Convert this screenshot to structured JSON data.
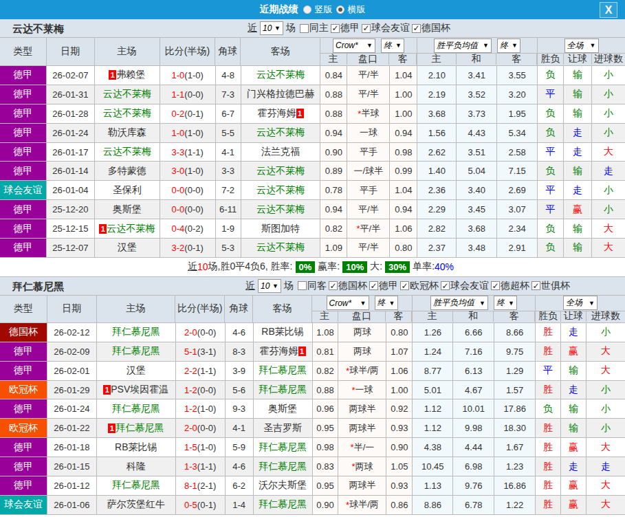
{
  "titlebar": {
    "title": "近期战绩",
    "radio_vertical": "竖版",
    "radio_horizontal": "横版",
    "selected": "横版",
    "close": "X"
  },
  "palette": {
    "header_blue": "#1896d5",
    "chrome": "#dbe4ec",
    "border": "#bbbbbb",
    "alt_row": "#f0f0f0",
    "asian_bg": "#fefaf8",
    "euro_bg": "#f2f9fd",
    "focus_green": "#008000",
    "red": "#ff0000",
    "blue": "#0000ff",
    "text": "#333333",
    "league_colors": {
      "德甲": "#990099",
      "球会友谊": "#00a8a8",
      "德国杯": "#a00800",
      "欧冠杯": "#f75000"
    },
    "result_colors": {
      "胜": "#ff0000",
      "平": "#0000ff",
      "负": "#008000",
      "赢": "#ff0000",
      "走": "#0000ff",
      "输": "#008000",
      "大": "#ff0000",
      "小": "#008000"
    }
  },
  "sections": [
    {
      "team": "云达不莱梅",
      "filter": {
        "near_label": "近",
        "count": "10",
        "games_label": "场"
      },
      "checkboxes": [
        {
          "label": "同主",
          "checked": false
        },
        {
          "label": "德甲",
          "checked": true
        },
        {
          "label": "球会友谊",
          "checked": true
        },
        {
          "label": "德国杯",
          "checked": true
        }
      ],
      "header": {
        "cols": [
          "类型",
          "日期",
          "主场",
          "比分(半场)",
          "角球",
          "客场"
        ],
        "selects": [
          "Crow*",
          "终",
          "胜平负均值",
          "终",
          "全场"
        ],
        "sub": [
          "主",
          "盘口",
          "客",
          "主",
          "和",
          "客",
          "胜负",
          "让球",
          "进球数"
        ]
      },
      "rows": [
        {
          "league": "德甲",
          "date": "26-02-07",
          "home": {
            "n": "弗赖堡",
            "pre": "1",
            "post": "",
            "f": false
          },
          "ft": "1-0",
          "ht": "(1-0)",
          "corner": "4-8",
          "away": {
            "n": "云达不莱梅",
            "pre": "",
            "post": "",
            "f": true
          },
          "w1": "0.84",
          "hcap": "平/半",
          "w2": "1.04",
          "o1": "2.10",
          "o2": "3.41",
          "o3": "3.55",
          "r1": "负",
          "r2": "输",
          "r3": "小"
        },
        {
          "league": "德甲",
          "date": "26-01-31",
          "home": {
            "n": "云达不莱梅",
            "pre": "",
            "post": "",
            "f": true
          },
          "ft": "1-1",
          "ht": "(0-0)",
          "corner": "7-3",
          "away": {
            "n": "门兴格拉德巴赫",
            "pre": "",
            "post": "",
            "f": false
          },
          "w1": "0.88",
          "hcap": "平/半",
          "w2": "1.00",
          "o1": "2.19",
          "o2": "3.52",
          "o3": "3.20",
          "r1": "平",
          "r2": "输",
          "r3": "小"
        },
        {
          "league": "德甲",
          "date": "26-01-28",
          "home": {
            "n": "云达不莱梅",
            "pre": "",
            "post": "",
            "f": true
          },
          "ft": "0-2",
          "ht": "(0-1)",
          "corner": "6-7",
          "away": {
            "n": "霍芬海姆",
            "pre": "",
            "post": "1",
            "f": false
          },
          "w1": "0.88",
          "hcap": "*半球",
          "w2": "1.00",
          "o1": "3.68",
          "o2": "3.73",
          "o3": "1.95",
          "r1": "负",
          "r2": "输",
          "r3": "小"
        },
        {
          "league": "德甲",
          "date": "26-01-24",
          "home": {
            "n": "勒沃库森",
            "pre": "",
            "post": "",
            "f": false
          },
          "ft": "1-0",
          "ht": "(1-0)",
          "corner": "5-5",
          "away": {
            "n": "云达不莱梅",
            "pre": "",
            "post": "",
            "f": true
          },
          "w1": "0.94",
          "hcap": "一球",
          "w2": "0.94",
          "o1": "1.56",
          "o2": "4.43",
          "o3": "5.34",
          "r1": "负",
          "r2": "走",
          "r3": "小"
        },
        {
          "league": "德甲",
          "date": "26-01-17",
          "home": {
            "n": "云达不莱梅",
            "pre": "",
            "post": "",
            "f": true
          },
          "ft": "3-3",
          "ht": "(1-1)",
          "corner": "4-1",
          "away": {
            "n": "法兰克福",
            "pre": "",
            "post": "",
            "f": false
          },
          "w1": "0.90",
          "hcap": "平手",
          "w2": "0.98",
          "o1": "2.62",
          "o2": "3.51",
          "o3": "2.58",
          "r1": "平",
          "r2": "走",
          "r3": "大"
        },
        {
          "league": "德甲",
          "date": "26-01-14",
          "home": {
            "n": "多特蒙德",
            "pre": "",
            "post": "",
            "f": false
          },
          "ft": "3-0",
          "ht": "(1-0)",
          "corner": "3-3",
          "away": {
            "n": "云达不莱梅",
            "pre": "",
            "post": "",
            "f": true
          },
          "w1": "0.89",
          "hcap": "一/球半",
          "w2": "0.99",
          "o1": "1.40",
          "o2": "5.04",
          "o3": "7.15",
          "r1": "负",
          "r2": "输",
          "r3": "走"
        },
        {
          "league": "球会友谊",
          "date": "26-01-04",
          "home": {
            "n": "圣保利",
            "pre": "",
            "post": "",
            "f": false
          },
          "ft": "0-0",
          "ht": "(0-0)",
          "corner": "7-2",
          "away": {
            "n": "云达不莱梅",
            "pre": "",
            "post": "",
            "f": true
          },
          "w1": "0.78",
          "hcap": "平手",
          "w2": "1.04",
          "o1": "2.36",
          "o2": "3.40",
          "o3": "2.69",
          "r1": "平",
          "r2": "走",
          "r3": "小"
        },
        {
          "league": "德甲",
          "date": "25-12-20",
          "home": {
            "n": "奥斯堡",
            "pre": "",
            "post": "",
            "f": false
          },
          "ft": "0-0",
          "ht": "(0-0)",
          "corner": "6-11",
          "away": {
            "n": "云达不莱梅",
            "pre": "",
            "post": "",
            "f": true
          },
          "w1": "0.94",
          "hcap": "平/半",
          "w2": "0.94",
          "o1": "2.29",
          "o2": "3.45",
          "o3": "3.07",
          "r1": "平",
          "r2": "赢",
          "r3": "小"
        },
        {
          "league": "德甲",
          "date": "25-12-15",
          "home": {
            "n": "云达不莱梅",
            "pre": "1",
            "post": "",
            "f": true
          },
          "ft": "0-4",
          "ht": "(0-2)",
          "corner": "1-9",
          "away": {
            "n": "斯图加特",
            "pre": "",
            "post": "",
            "f": false
          },
          "w1": "0.82",
          "hcap": "*平/半",
          "w2": "1.06",
          "o1": "2.82",
          "o2": "3.68",
          "o3": "2.34",
          "r1": "负",
          "r2": "输",
          "r3": "大"
        },
        {
          "league": "德甲",
          "date": "25-12-07",
          "home": {
            "n": "汉堡",
            "pre": "",
            "post": "",
            "f": false
          },
          "ft": "3-2",
          "ht": "(0-1)",
          "corner": "5-3",
          "away": {
            "n": "云达不莱梅",
            "pre": "",
            "post": "",
            "f": true
          },
          "w1": "1.09",
          "hcap": "平/半",
          "w2": "0.80",
          "o1": "2.37",
          "o2": "3.48",
          "o3": "2.91",
          "r1": "负",
          "r2": "输",
          "r3": "大"
        }
      ],
      "summary": {
        "near": "近",
        "count": "10",
        "text": "场,胜0平4负6, 胜率:",
        "win": "0%",
        "label2": "赢率:",
        "win2": "10%",
        "label3": "大:",
        "big": "30%",
        "label4": "单率:",
        "single": "40%"
      }
    },
    {
      "team": "拜仁慕尼黑",
      "filter": {
        "near_label": "近",
        "count": "10",
        "games_label": "场"
      },
      "checkboxes": [
        {
          "label": "同客",
          "checked": false
        },
        {
          "label": "德国杯",
          "checked": true
        },
        {
          "label": "德甲",
          "checked": true
        },
        {
          "label": "欧冠杯",
          "checked": true
        },
        {
          "label": "球会友谊",
          "checked": true
        },
        {
          "label": "德超杯",
          "checked": true
        },
        {
          "label": "世俱杯",
          "checked": true
        }
      ],
      "header": {
        "cols": [
          "类型",
          "日期",
          "主场",
          "比分(半场)",
          "角球",
          "客场"
        ],
        "selects": [
          "Crow*",
          "终",
          "胜平负均值",
          "终",
          "全场"
        ],
        "sub": [
          "主",
          "盘口",
          "客",
          "主",
          "和",
          "客",
          "胜负",
          "让球",
          "进球数"
        ]
      },
      "rows": [
        {
          "league": "德国杯",
          "date": "26-02-12",
          "home": {
            "n": "拜仁慕尼黑",
            "pre": "",
            "post": "",
            "f": true
          },
          "ft": "2-0",
          "ht": "(0-0)",
          "corner": "4-6",
          "away": {
            "n": "RB莱比锡",
            "pre": "",
            "post": "",
            "f": false
          },
          "w1": "1.08",
          "hcap": "两球",
          "w2": "0.80",
          "o1": "1.26",
          "o2": "6.66",
          "o3": "8.66",
          "r1": "胜",
          "r2": "走",
          "r3": "小"
        },
        {
          "league": "德甲",
          "date": "26-02-09",
          "home": {
            "n": "拜仁慕尼黑",
            "pre": "",
            "post": "",
            "f": true
          },
          "ft": "5-1",
          "ht": "(3-1)",
          "corner": "8-3",
          "away": {
            "n": "霍芬海姆",
            "pre": "",
            "post": "1",
            "f": false
          },
          "w1": "0.81",
          "hcap": "两球",
          "w2": "1.07",
          "o1": "1.24",
          "o2": "7.16",
          "o3": "9.75",
          "r1": "胜",
          "r2": "赢",
          "r3": "大"
        },
        {
          "league": "德甲",
          "date": "26-02-01",
          "home": {
            "n": "汉堡",
            "pre": "",
            "post": "",
            "f": false
          },
          "ft": "2-2",
          "ht": "(1-1)",
          "corner": "3-9",
          "away": {
            "n": "拜仁慕尼黑",
            "pre": "",
            "post": "",
            "f": true
          },
          "w1": "0.82",
          "hcap": "*球半/两",
          "w2": "1.06",
          "o1": "8.77",
          "o2": "6.13",
          "o3": "1.29",
          "r1": "平",
          "r2": "输",
          "r3": "大"
        },
        {
          "league": "欧冠杯",
          "date": "26-01-29",
          "home": {
            "n": "PSV埃因霍温",
            "pre": "1",
            "post": "",
            "f": false
          },
          "ft": "1-2",
          "ht": "(0-0)",
          "corner": "5-6",
          "away": {
            "n": "拜仁慕尼黑",
            "pre": "",
            "post": "",
            "f": true
          },
          "w1": "0.88",
          "hcap": "*一球",
          "w2": "1.00",
          "o1": "5.01",
          "o2": "4.67",
          "o3": "1.57",
          "r1": "胜",
          "r2": "走",
          "r3": "小"
        },
        {
          "league": "德甲",
          "date": "26-01-24",
          "home": {
            "n": "拜仁慕尼黑",
            "pre": "",
            "post": "",
            "f": true
          },
          "ft": "1-2",
          "ht": "(1-0)",
          "corner": "9-3",
          "away": {
            "n": "奥斯堡",
            "pre": "",
            "post": "",
            "f": false
          },
          "w1": "0.96",
          "hcap": "两球半",
          "w2": "0.92",
          "o1": "1.12",
          "o2": "10.01",
          "o3": "17.86",
          "r1": "负",
          "r2": "输",
          "r3": "小"
        },
        {
          "league": "欧冠杯",
          "date": "26-01-22",
          "home": {
            "n": "拜仁慕尼黑",
            "pre": "1",
            "post": "",
            "f": true
          },
          "ft": "2-0",
          "ht": "(0-0)",
          "corner": "4-1",
          "away": {
            "n": "圣吉罗斯",
            "pre": "",
            "post": "",
            "f": false
          },
          "w1": "0.95",
          "hcap": "两球半",
          "w2": "0.93",
          "o1": "1.12",
          "o2": "9.98",
          "o3": "18.30",
          "r1": "胜",
          "r2": "输",
          "r3": "小"
        },
        {
          "league": "德甲",
          "date": "26-01-18",
          "home": {
            "n": "RB莱比锡",
            "pre": "",
            "post": "",
            "f": false
          },
          "ft": "1-5",
          "ht": "(1-0)",
          "corner": "5-9",
          "away": {
            "n": "拜仁慕尼黑",
            "pre": "",
            "post": "",
            "f": true
          },
          "w1": "0.98",
          "hcap": "*半/一",
          "w2": "0.90",
          "o1": "4.38",
          "o2": "4.44",
          "o3": "1.67",
          "r1": "胜",
          "r2": "赢",
          "r3": "大"
        },
        {
          "league": "德甲",
          "date": "26-01-15",
          "home": {
            "n": "科隆",
            "pre": "",
            "post": "",
            "f": false
          },
          "ft": "1-3",
          "ht": "(1-1)",
          "corner": "4-6",
          "away": {
            "n": "拜仁慕尼黑",
            "pre": "",
            "post": "",
            "f": true
          },
          "w1": "0.83",
          "hcap": "*两球",
          "w2": "1.05",
          "o1": "10.45",
          "o2": "6.98",
          "o3": "1.23",
          "r1": "胜",
          "r2": "走",
          "r3": "走"
        },
        {
          "league": "德甲",
          "date": "26-01-12",
          "home": {
            "n": "拜仁慕尼黑",
            "pre": "",
            "post": "",
            "f": true
          },
          "ft": "8-1",
          "ht": "(2-1)",
          "corner": "6-2",
          "away": {
            "n": "沃尔夫斯堡",
            "pre": "",
            "post": "",
            "f": false
          },
          "w1": "0.95",
          "hcap": "两球半",
          "w2": "0.93",
          "o1": "1.13",
          "o2": "9.76",
          "o3": "16.86",
          "r1": "胜",
          "r2": "赢",
          "r3": "大"
        },
        {
          "league": "球会友谊",
          "date": "26-01-06",
          "home": {
            "n": "萨尔茨堡红牛",
            "pre": "",
            "post": "",
            "f": false
          },
          "ft": "0-5",
          "ht": "(0-1)",
          "corner": "1-4",
          "away": {
            "n": "拜仁慕尼黑",
            "pre": "",
            "post": "",
            "f": true
          },
          "w1": "0.90",
          "hcap": "*球半/两",
          "w2": "0.86",
          "o1": "8.86",
          "o2": "6.78",
          "o3": "1.22",
          "r1": "胜",
          "r2": "赢",
          "r3": "大"
        }
      ]
    }
  ]
}
